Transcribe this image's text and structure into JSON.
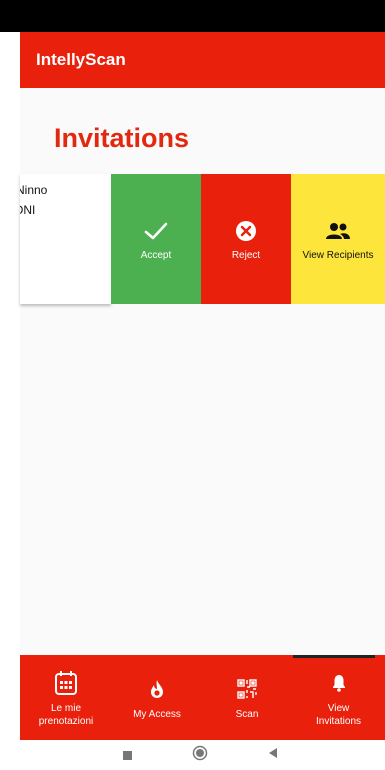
{
  "app": {
    "title": "IntellyScan"
  },
  "page": {
    "title": "Invitations"
  },
  "invitation": {
    "line1": "Ninno",
    "line2": "ONI"
  },
  "actions": {
    "accept_label": "Accept",
    "reject_label": "Reject",
    "recipients_label": "View Recipients"
  },
  "bottom_nav": {
    "items": [
      {
        "label": "Le mie prenotazioni",
        "icon": "calendar-icon"
      },
      {
        "label": "My Access",
        "icon": "flame-icon"
      },
      {
        "label": "Scan",
        "icon": "qr-code-icon"
      },
      {
        "label": "View Invitations",
        "icon": "bell-icon",
        "active": true
      }
    ]
  },
  "colors": {
    "primary": "#e8200c",
    "accept": "#4caf50",
    "reject": "#e8200c",
    "recipients": "#fde53b"
  }
}
